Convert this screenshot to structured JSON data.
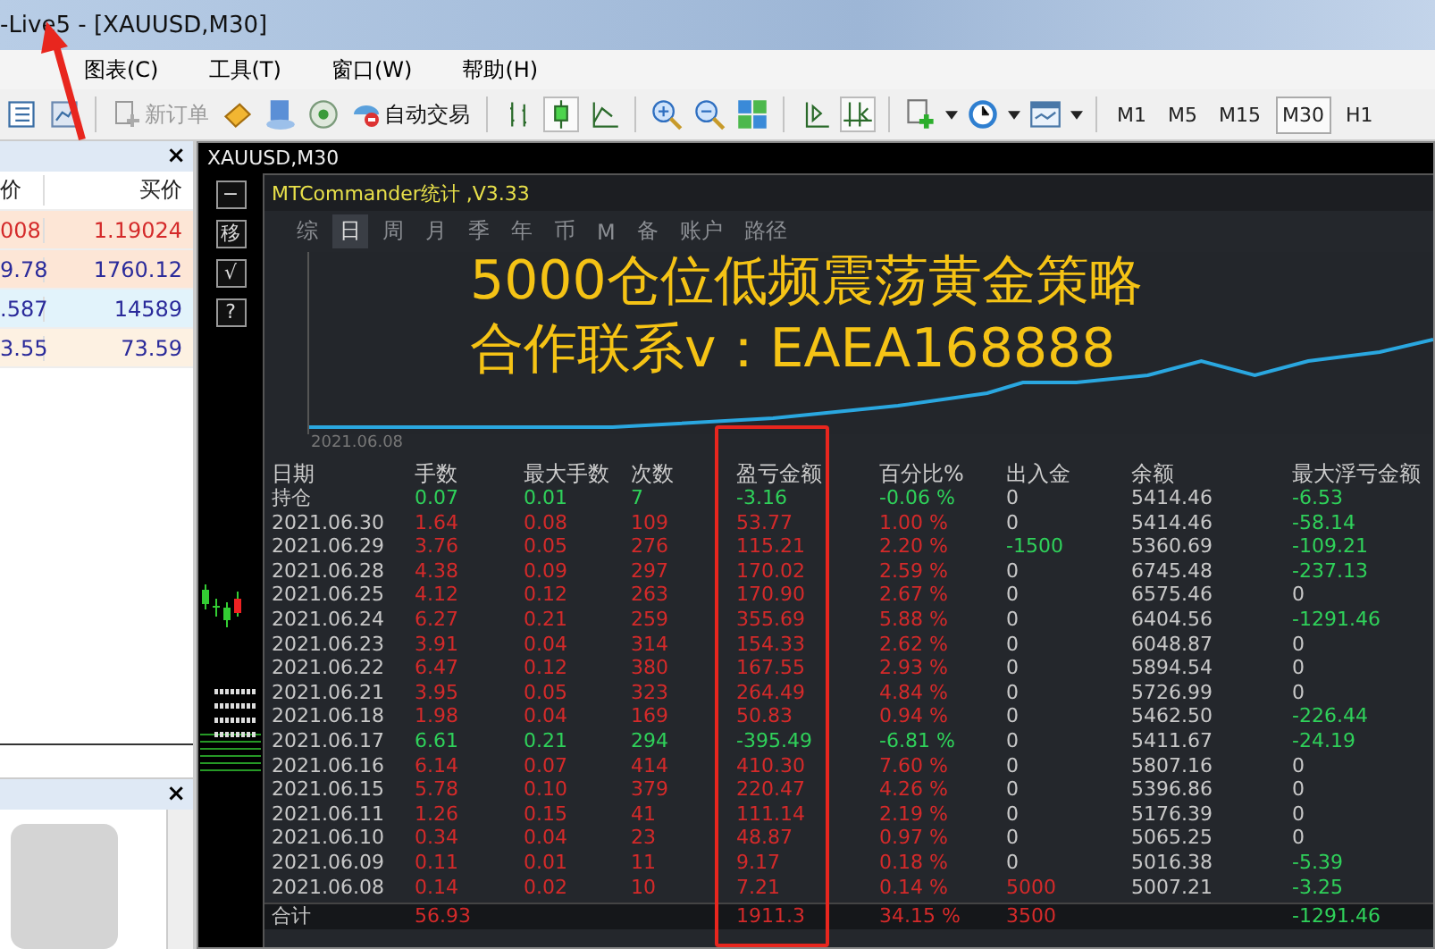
{
  "window": {
    "title": "-Live5 - [XAUUSD,M30]"
  },
  "menu": [
    {
      "label": "图表(C)"
    },
    {
      "label": "工具(T)"
    },
    {
      "label": "窗口(W)"
    },
    {
      "label": "帮助(H)"
    }
  ],
  "toolbar": {
    "new_order": {
      "label": "新订单",
      "disabled": true
    },
    "auto_trade": {
      "label": "自动交易"
    },
    "timeframes": [
      {
        "label": "M1",
        "selected": false
      },
      {
        "label": "M5",
        "selected": false
      },
      {
        "label": "M15",
        "selected": false
      },
      {
        "label": "M30",
        "selected": true
      },
      {
        "label": "H1",
        "selected": false
      }
    ]
  },
  "market_watch": {
    "close": "×",
    "columns": [
      "价",
      "买价"
    ],
    "rows": [
      {
        "bid": "008",
        "ask": "1.19024",
        "color": "#d42a2a"
      },
      {
        "bid": "9.78",
        "ask": "1760.12",
        "color": "#2a2a9a"
      },
      {
        "bid": ".587",
        "ask": "14589",
        "color": "#2a2a9a"
      },
      {
        "bid": "3.55",
        "ask": "73.59",
        "color": "#2a2a9a"
      }
    ]
  },
  "navigator": {
    "close": "×"
  },
  "chart": {
    "title": "XAUUSD,M30",
    "side_buttons": [
      "−",
      "移",
      "√",
      "?"
    ],
    "stats": {
      "title": "MTCommander统计 ,V3.33",
      "tabs": [
        {
          "label": "综",
          "selected": false
        },
        {
          "label": "日",
          "selected": true
        },
        {
          "label": "周",
          "selected": false
        },
        {
          "label": "月",
          "selected": false
        },
        {
          "label": "季",
          "selected": false
        },
        {
          "label": "年",
          "selected": false
        },
        {
          "label": "币",
          "selected": false
        },
        {
          "label": "M",
          "selected": false
        },
        {
          "label": "备",
          "selected": false
        },
        {
          "label": "账户",
          "selected": false
        },
        {
          "label": "路径",
          "selected": false
        }
      ],
      "curve_label": "2021.06.08",
      "overlay": [
        "5000仓位低频震荡黄金策略",
        "合作联系v：EAEA168888"
      ],
      "columns": [
        "日期",
        "手数",
        "最大手数",
        "次数",
        "盈亏金额",
        "百分比%",
        "出入金",
        "余额",
        "最大浮亏金额"
      ],
      "rows": [
        {
          "date": "持仓",
          "lots": "0.07",
          "max_lots": "0.01",
          "count": "7",
          "pnl": "-3.16",
          "pct": "-0.06 %",
          "color": "#2fd15a",
          "cash": {
            "text": "0",
            "color": "#c8c8c8"
          },
          "balance": "5414.46",
          "max_float": {
            "text": "-6.53",
            "color": "#2fd15a"
          }
        },
        {
          "date": "2021.06.30",
          "lots": "1.64",
          "max_lots": "0.08",
          "count": "109",
          "pnl": "53.77",
          "pct": "1.00 %",
          "color": "#d42a2a",
          "cash": {
            "text": "0",
            "color": "#c8c8c8"
          },
          "balance": "5414.46",
          "max_float": {
            "text": "-58.14",
            "color": "#2fd15a"
          }
        },
        {
          "date": "2021.06.29",
          "lots": "3.76",
          "max_lots": "0.05",
          "count": "276",
          "pnl": "115.21",
          "pct": "2.20 %",
          "color": "#d42a2a",
          "cash": {
            "text": "-1500",
            "color": "#2fd15a"
          },
          "balance": "5360.69",
          "max_float": {
            "text": "-109.21",
            "color": "#2fd15a"
          }
        },
        {
          "date": "2021.06.28",
          "lots": "4.38",
          "max_lots": "0.09",
          "count": "297",
          "pnl": "170.02",
          "pct": "2.59 %",
          "color": "#d42a2a",
          "cash": {
            "text": "0",
            "color": "#c8c8c8"
          },
          "balance": "6745.48",
          "max_float": {
            "text": "-237.13",
            "color": "#2fd15a"
          }
        },
        {
          "date": "2021.06.25",
          "lots": "4.12",
          "max_lots": "0.12",
          "count": "263",
          "pnl": "170.90",
          "pct": "2.67 %",
          "color": "#d42a2a",
          "cash": {
            "text": "0",
            "color": "#c8c8c8"
          },
          "balance": "6575.46",
          "max_float": {
            "text": "0",
            "color": "#c8c8c8"
          }
        },
        {
          "date": "2021.06.24",
          "lots": "6.27",
          "max_lots": "0.21",
          "count": "259",
          "pnl": "355.69",
          "pct": "5.88 %",
          "color": "#d42a2a",
          "cash": {
            "text": "0",
            "color": "#c8c8c8"
          },
          "balance": "6404.56",
          "max_float": {
            "text": "-1291.46",
            "color": "#2fd15a"
          }
        },
        {
          "date": "2021.06.23",
          "lots": "3.91",
          "max_lots": "0.04",
          "count": "314",
          "pnl": "154.33",
          "pct": "2.62 %",
          "color": "#d42a2a",
          "cash": {
            "text": "0",
            "color": "#c8c8c8"
          },
          "balance": "6048.87",
          "max_float": {
            "text": "0",
            "color": "#c8c8c8"
          }
        },
        {
          "date": "2021.06.22",
          "lots": "6.47",
          "max_lots": "0.12",
          "count": "380",
          "pnl": "167.55",
          "pct": "2.93 %",
          "color": "#d42a2a",
          "cash": {
            "text": "0",
            "color": "#c8c8c8"
          },
          "balance": "5894.54",
          "max_float": {
            "text": "0",
            "color": "#c8c8c8"
          }
        },
        {
          "date": "2021.06.21",
          "lots": "3.95",
          "max_lots": "0.05",
          "count": "323",
          "pnl": "264.49",
          "pct": "4.84 %",
          "color": "#d42a2a",
          "cash": {
            "text": "0",
            "color": "#c8c8c8"
          },
          "balance": "5726.99",
          "max_float": {
            "text": "0",
            "color": "#c8c8c8"
          }
        },
        {
          "date": "2021.06.18",
          "lots": "1.98",
          "max_lots": "0.04",
          "count": "169",
          "pnl": "50.83",
          "pct": "0.94 %",
          "color": "#d42a2a",
          "cash": {
            "text": "0",
            "color": "#c8c8c8"
          },
          "balance": "5462.50",
          "max_float": {
            "text": "-226.44",
            "color": "#2fd15a"
          }
        },
        {
          "date": "2021.06.17",
          "lots": "6.61",
          "max_lots": "0.21",
          "count": "294",
          "pnl": "-395.49",
          "pct": "-6.81 %",
          "color": "#2fd15a",
          "cash": {
            "text": "0",
            "color": "#c8c8c8"
          },
          "balance": "5411.67",
          "max_float": {
            "text": "-24.19",
            "color": "#2fd15a"
          }
        },
        {
          "date": "2021.06.16",
          "lots": "6.14",
          "max_lots": "0.07",
          "count": "414",
          "pnl": "410.30",
          "pct": "7.60 %",
          "color": "#d42a2a",
          "cash": {
            "text": "0",
            "color": "#c8c8c8"
          },
          "balance": "5807.16",
          "max_float": {
            "text": "0",
            "color": "#c8c8c8"
          }
        },
        {
          "date": "2021.06.15",
          "lots": "5.78",
          "max_lots": "0.10",
          "count": "379",
          "pnl": "220.47",
          "pct": "4.26 %",
          "color": "#d42a2a",
          "cash": {
            "text": "0",
            "color": "#c8c8c8"
          },
          "balance": "5396.86",
          "max_float": {
            "text": "0",
            "color": "#c8c8c8"
          }
        },
        {
          "date": "2021.06.11",
          "lots": "1.26",
          "max_lots": "0.15",
          "count": "41",
          "pnl": "111.14",
          "pct": "2.19 %",
          "color": "#d42a2a",
          "cash": {
            "text": "0",
            "color": "#c8c8c8"
          },
          "balance": "5176.39",
          "max_float": {
            "text": "0",
            "color": "#c8c8c8"
          }
        },
        {
          "date": "2021.06.10",
          "lots": "0.34",
          "max_lots": "0.04",
          "count": "23",
          "pnl": "48.87",
          "pct": "0.97 %",
          "color": "#d42a2a",
          "cash": {
            "text": "0",
            "color": "#c8c8c8"
          },
          "balance": "5065.25",
          "max_float": {
            "text": "0",
            "color": "#c8c8c8"
          }
        },
        {
          "date": "2021.06.09",
          "lots": "0.11",
          "max_lots": "0.01",
          "count": "11",
          "pnl": "9.17",
          "pct": "0.18 %",
          "color": "#d42a2a",
          "cash": {
            "text": "0",
            "color": "#c8c8c8"
          },
          "balance": "5016.38",
          "max_float": {
            "text": "-5.39",
            "color": "#2fd15a"
          }
        },
        {
          "date": "2021.06.08",
          "lots": "0.14",
          "max_lots": "0.02",
          "count": "10",
          "pnl": "7.21",
          "pct": "0.14 %",
          "color": "#d42a2a",
          "cash": {
            "text": "5000",
            "color": "#d42a2a"
          },
          "balance": "5007.21",
          "max_float": {
            "text": "-3.25",
            "color": "#2fd15a"
          }
        }
      ],
      "total": {
        "label": "合计",
        "lots": "56.93",
        "pnl": "1911.3",
        "pct": "34.15 %",
        "cash": "3500",
        "max_float": "-1291.46"
      }
    }
  }
}
